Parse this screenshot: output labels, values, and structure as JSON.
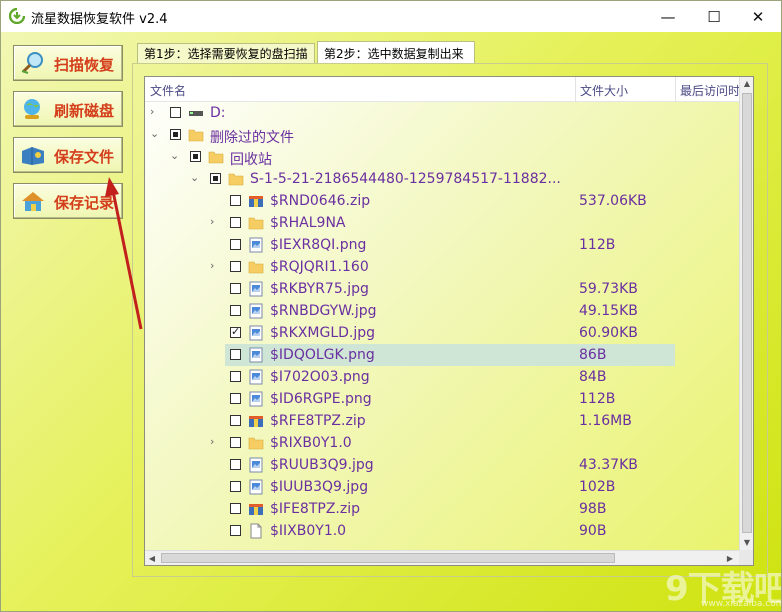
{
  "window": {
    "title": "流星数据恢复软件 v2.4",
    "controls": {
      "minimize": "—",
      "maximize": "☐",
      "close": "✕"
    }
  },
  "sidebar": {
    "buttons": [
      {
        "label": "扫描恢复",
        "icon": "magnifier-icon"
      },
      {
        "label": "刷新磁盘",
        "icon": "globe-refresh-icon"
      },
      {
        "label": "保存文件",
        "icon": "save-file-icon"
      },
      {
        "label": "保存记录",
        "icon": "house-icon"
      }
    ]
  },
  "tabs": [
    {
      "label": "第1步：选择需要恢复的盘扫描",
      "active": false
    },
    {
      "label": "第2步：选中数据复制出来",
      "active": true
    }
  ],
  "columns": {
    "name": "文件名",
    "size": "文件大小",
    "accessed": "最后访问时"
  },
  "rows": [
    {
      "level": 0,
      "expander": "›",
      "check": "none",
      "icon": "drive-icon",
      "name": "D:",
      "size": ""
    },
    {
      "level": 0,
      "expander": "⌄",
      "check": "partial",
      "icon": "folder-icon",
      "name": "删除过的文件",
      "size": ""
    },
    {
      "level": 1,
      "expander": "⌄",
      "check": "partial",
      "icon": "folder-icon",
      "name": "回收站",
      "size": ""
    },
    {
      "level": 2,
      "expander": "⌄",
      "check": "partial",
      "icon": "folder-icon",
      "name": "S-1-5-21-2186544480-1259784517-11882...",
      "size": ""
    },
    {
      "level": 3,
      "expander": "",
      "check": "none",
      "icon": "zip-icon",
      "name": "$RND0646.zip",
      "size": "537.06KB"
    },
    {
      "level": 3,
      "expander": "›",
      "check": "none",
      "icon": "folder-icon",
      "name": "$RHAL9NA",
      "size": ""
    },
    {
      "level": 3,
      "expander": "",
      "check": "none",
      "icon": "image-icon",
      "name": "$IEXR8QI.png",
      "size": "112B"
    },
    {
      "level": 3,
      "expander": "›",
      "check": "none",
      "icon": "folder-icon",
      "name": "$RQJQRI1.160",
      "size": ""
    },
    {
      "level": 3,
      "expander": "",
      "check": "none",
      "icon": "image-icon",
      "name": "$RKBYR75.jpg",
      "size": "59.73KB"
    },
    {
      "level": 3,
      "expander": "",
      "check": "none",
      "icon": "image-icon",
      "name": "$RNBDGYW.jpg",
      "size": "49.15KB"
    },
    {
      "level": 3,
      "expander": "",
      "check": "checked",
      "icon": "image-icon",
      "name": "$RKXMGLD.jpg",
      "size": "60.90KB"
    },
    {
      "level": 3,
      "expander": "",
      "check": "none",
      "icon": "image-icon",
      "name": "$IDQOLGK.png",
      "size": "86B",
      "selected": true
    },
    {
      "level": 3,
      "expander": "",
      "check": "none",
      "icon": "image-icon",
      "name": "$I702O03.png",
      "size": "84B"
    },
    {
      "level": 3,
      "expander": "",
      "check": "none",
      "icon": "image-icon",
      "name": "$ID6RGPE.png",
      "size": "112B"
    },
    {
      "level": 3,
      "expander": "",
      "check": "none",
      "icon": "zip-icon",
      "name": "$RFE8TPZ.zip",
      "size": "1.16MB"
    },
    {
      "level": 3,
      "expander": "›",
      "check": "none",
      "icon": "folder-icon",
      "name": "$RIXB0Y1.0",
      "size": ""
    },
    {
      "level": 3,
      "expander": "",
      "check": "none",
      "icon": "image-icon",
      "name": "$RUUB3Q9.jpg",
      "size": "43.37KB"
    },
    {
      "level": 3,
      "expander": "",
      "check": "none",
      "icon": "image-icon",
      "name": "$IUUB3Q9.jpg",
      "size": "102B"
    },
    {
      "level": 3,
      "expander": "",
      "check": "none",
      "icon": "zip-icon",
      "name": "$IFE8TPZ.zip",
      "size": "98B"
    },
    {
      "level": 3,
      "expander": "",
      "check": "none",
      "icon": "file-icon",
      "name": "$IIXB0Y1.0",
      "size": "90B"
    }
  ],
  "watermark": {
    "logo": "9下载吧",
    "url": "www.xiazaiba.com"
  },
  "colors": {
    "accent": "#d43e1b",
    "filename": "#6a2fa0",
    "selected_row": "#cfe5d6",
    "background": "#e6f15a"
  }
}
